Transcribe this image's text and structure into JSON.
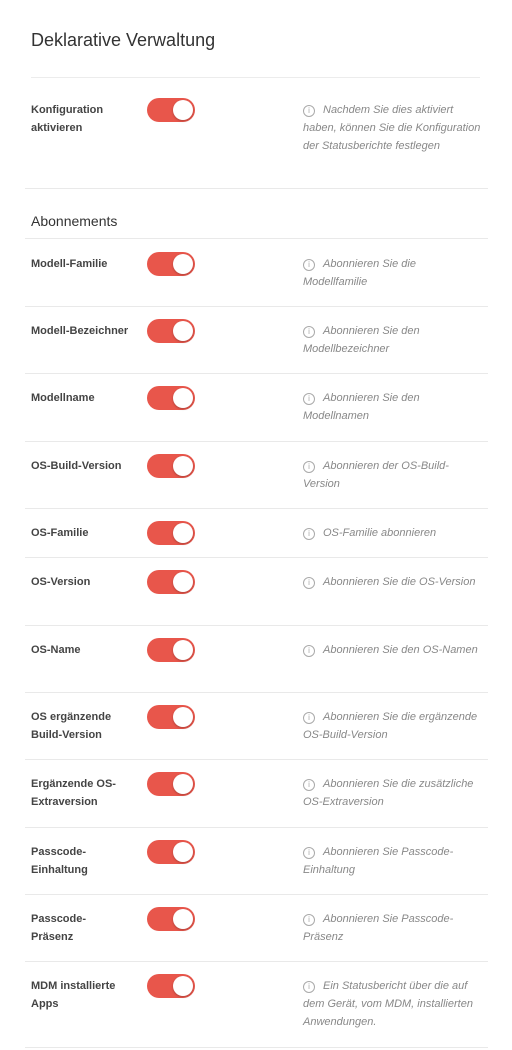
{
  "header": {
    "title": "Deklarative Verwaltung"
  },
  "config": {
    "label": "Konfiguration aktivieren",
    "enabled": true,
    "help": "Nachdem Sie dies aktiviert haben, können Sie die Konfiguration der Statusberichte festlegen"
  },
  "subscriptions": {
    "heading": "Abonnements",
    "items": [
      {
        "label": "Modell-Familie",
        "enabled": true,
        "help": "Abonnieren Sie die Modellfamilie"
      },
      {
        "label": "Modell-Bezeichner",
        "enabled": true,
        "help": "Abonnieren Sie den Modellbezeichner"
      },
      {
        "label": "Modellname",
        "enabled": true,
        "help": "Abonnieren Sie den Modellnamen"
      },
      {
        "label": "OS-Build-Version",
        "enabled": true,
        "help": "Abonnieren der OS-Build-Version"
      },
      {
        "label": "OS-Familie",
        "enabled": true,
        "help": "OS-Familie abonnieren"
      },
      {
        "label": "OS-Version",
        "enabled": true,
        "help": "Abonnieren Sie die OS-Version"
      },
      {
        "label": "OS-Name",
        "enabled": true,
        "help": "Abonnieren Sie den OS-Namen"
      },
      {
        "label": "OS ergänzende Build-Version",
        "enabled": true,
        "help": "Abonnieren Sie die ergänzende OS-Build-Version"
      },
      {
        "label": "Ergänzende OS-Extraversion",
        "enabled": true,
        "help": "Abonnieren Sie die zusätzliche OS-Extraversion"
      },
      {
        "label": "Passcode-Einhaltung",
        "enabled": true,
        "help": "Abonnieren Sie Passcode-Einhaltung"
      },
      {
        "label": "Passcode-Präsenz",
        "enabled": true,
        "help": "Abonnieren Sie Passcode-Präsenz"
      },
      {
        "label": "MDM installierte Apps",
        "enabled": true,
        "help": "Ein Statusbericht über die auf dem Gerät, vom MDM, installierten Anwendungen."
      }
    ]
  },
  "colors": {
    "toggle_on": "#e8564b"
  },
  "icons": {
    "info": "info-circle-icon"
  }
}
